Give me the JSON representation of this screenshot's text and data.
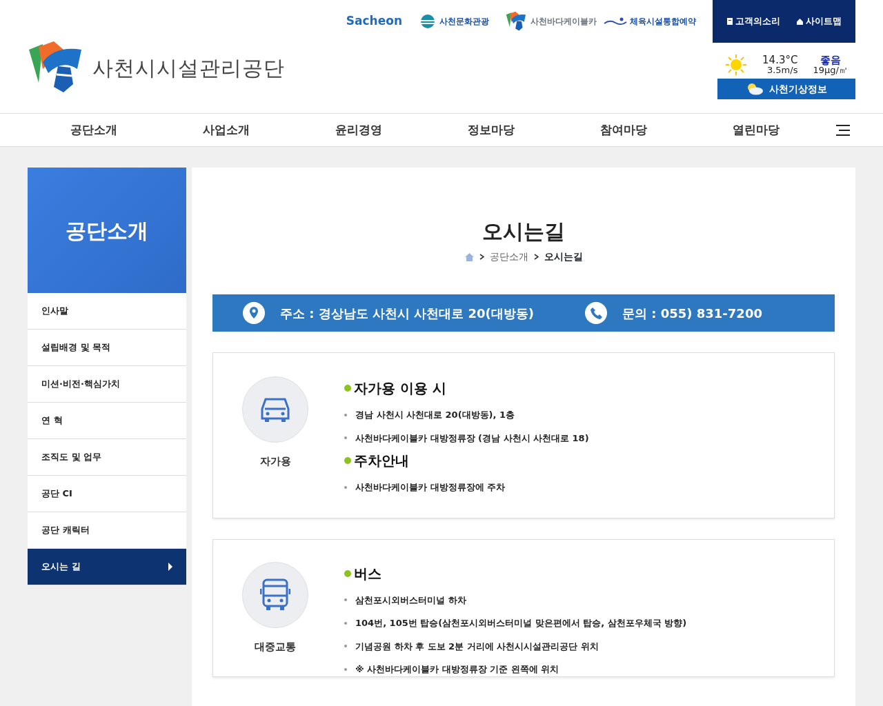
{
  "partner_links": [
    {
      "kind": "sacheon",
      "label": "Sacheon"
    },
    {
      "kind": "culture",
      "label": "사천문화관광"
    },
    {
      "kind": "cablecar",
      "label": "사천바다케이블카"
    },
    {
      "kind": "sports",
      "label": "체육시설통합예약"
    }
  ],
  "utility_links": [
    {
      "kind": "voice",
      "label": "고객의소리"
    },
    {
      "kind": "sitemap",
      "label": "사이트맵"
    }
  ],
  "logo": {
    "title": "사천시시설관리공단"
  },
  "weather": {
    "temperature": "14.3°C",
    "wind": "3.5m/s",
    "air_quality": "좋음",
    "dust": "19μg/㎥",
    "button": "사천기상정보"
  },
  "main_nav": [
    "공단소개",
    "사업소개",
    "윤리경영",
    "정보마당",
    "참여마당",
    "열린마당"
  ],
  "sidebar": {
    "title": "공단소개",
    "items": [
      {
        "label": "인사말",
        "selected": false
      },
      {
        "label": "설립배경 및 목적",
        "selected": false
      },
      {
        "label": "미션·비전·핵심가치",
        "selected": false
      },
      {
        "label": "연 혁",
        "selected": false
      },
      {
        "label": "조직도 및 업무",
        "selected": false
      },
      {
        "label": "공단 CI",
        "selected": false
      },
      {
        "label": "공단 캐릭터",
        "selected": false
      },
      {
        "label": "오시는 길",
        "selected": true
      }
    ]
  },
  "page": {
    "title": "오시는길",
    "breadcrumb": [
      "공단소개",
      "오시는길"
    ]
  },
  "contact_bar": {
    "address": "주소 : 경상남도 사천시 사천대로 20(대방동)",
    "phone": "문의 : 055) 831-7200"
  },
  "sections": [
    {
      "kind": "car",
      "caption": "자가용",
      "groups": [
        {
          "heading": "자가용 이용 시",
          "items": [
            "경남 사천시 사천대로 20(대방동), 1층",
            "사천바다케이블카 대방정류장 (경남 사천시 사천대로 18)"
          ]
        },
        {
          "heading": "주차안내",
          "items": [
            "사천바다케이블카 대방정류장에 주차"
          ]
        }
      ]
    },
    {
      "kind": "bus",
      "caption": "대중교통",
      "groups": [
        {
          "heading": "버스",
          "items": [
            "삼천포시외버스터미널 하차",
            "104번, 105번 탑승(삼천포시외버스터미널 맞은편에서 탑승, 삼천포우체국 방향)",
            "기념공원 하차 후 도보 2분 거리에 사천시시설관리공단 위치",
            "※ 사천바다케이블카 대방정류장 기준 왼쪽에 위치"
          ]
        }
      ]
    }
  ]
}
